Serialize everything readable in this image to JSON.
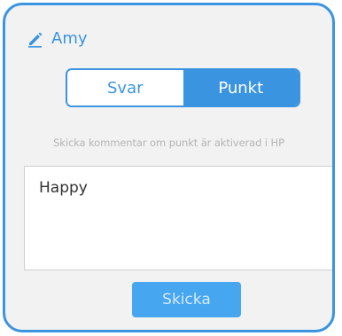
{
  "header": {
    "icon": "pencil-icon",
    "name": "Amy"
  },
  "segmented": {
    "options": [
      {
        "label": "Svar",
        "selected": false
      },
      {
        "label": "Punkt",
        "selected": true
      }
    ]
  },
  "hint": "Skicka kommentar om punkt är aktiverad i HP",
  "comment": {
    "value": "Happy"
  },
  "send_button": {
    "label": "Skicka"
  },
  "colors": {
    "accent": "#3b94e0",
    "button": "#46a6ef",
    "panel_bg": "#f2f2f2",
    "hint_text": "#b4b4b4"
  }
}
